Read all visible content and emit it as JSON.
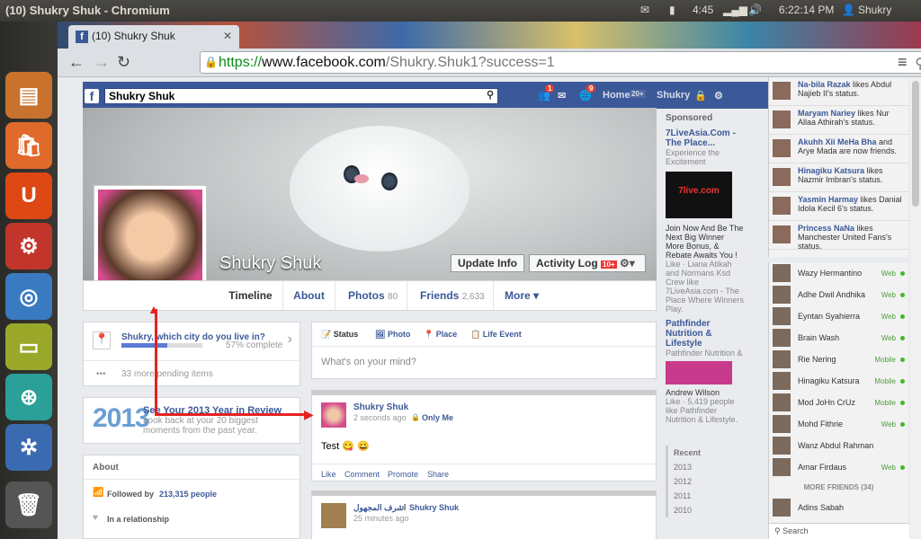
{
  "os": {
    "window_title": "(10) Shukry Shuk - Chromium",
    "time_left": "4:45",
    "clock": "6:22:14 PM",
    "user": "Shukry"
  },
  "browser": {
    "tab_title": "(10) Shukry Shuk",
    "url_https": "https://",
    "url_host": "www.facebook.com",
    "url_path": "/Shukry.Shuk1?success=1"
  },
  "fb": {
    "search_value": "Shukry Shuk",
    "friend_req_badge": "1",
    "notif_badge": "9",
    "home_label": "Home",
    "home_count": "20+",
    "user_label": "Shukry"
  },
  "profile": {
    "name": "Shukry Shuk",
    "update_info": "Update Info",
    "activity_log": "Activity Log",
    "activity_badge": "10+",
    "tabs": [
      {
        "label": "Timeline",
        "count": ""
      },
      {
        "label": "About",
        "count": ""
      },
      {
        "label": "Photos",
        "count": "80"
      },
      {
        "label": "Friends",
        "count": "2,633"
      },
      {
        "label": "More ▾",
        "count": ""
      }
    ]
  },
  "left": {
    "city_q": "Shukry, which city do you live in?",
    "city_pct": "57% complete",
    "city_progress": 0.57,
    "pending": "33 more pending items",
    "year_big": "2013",
    "year_title": "See Your 2013 Year in Review",
    "year_sub": "Look back at your 20 biggest moments from the past year.",
    "about": "About",
    "followed_prefix": "Followed by",
    "followed_count": "213,315 people",
    "relationship": "In a relationship"
  },
  "composer": {
    "tabs": [
      "Status",
      "Photo",
      "Place",
      "Life Event"
    ],
    "placeholder": "What's on your mind?"
  },
  "post": {
    "author": "Shukry Shuk",
    "time": "2 seconds ago",
    "privacy": "Only Me",
    "text": "Test 😋 😀",
    "actions": [
      "Like",
      "Comment",
      "Promote",
      "Share"
    ]
  },
  "post2": {
    "author_arabic": "اشرف المجهول",
    "target": "Shukry Shuk",
    "time": "25 minutes ago"
  },
  "ads": {
    "header": "Sponsored",
    "ad1_title": "7LiveAsia.Com - The Place...",
    "ad1_sub": "Experience the Excitement",
    "ad1_img": "7live.com",
    "ad1_body": "Join Now And Be The Next Big Winner More Bonus, & Rebate Awaits You !",
    "ad1_like": "Like · Liana Atikah and Normans Ksd Crew like 7LiveAsia.com - The Place Where Winners Play.",
    "ad2_title": "Pathfinder Nutrition & Lifestyle",
    "ad2_sub": "Pathfinder Nutrition &",
    "ad2_person": "Andrew Wilson",
    "ad2_like": "Like · 5,419 people like Pathfinder Nutrition & Lifestyle."
  },
  "years": {
    "recent": "Recent",
    "list": [
      "2013",
      "2012",
      "2011",
      "2010"
    ]
  },
  "ticker": [
    {
      "name": "Na-bila Razak",
      "text": "likes Abdul Najieb II's status."
    },
    {
      "name": "Maryam Nariey",
      "text": "likes Nur Allaa Athirah's status."
    },
    {
      "name": "Akuhh Xii MeHa Bha",
      "text": "and Arye Mada are now friends."
    },
    {
      "name": "Hinagiku Katsura",
      "text": "likes Nazmir Imbran's status."
    },
    {
      "name": "Yasmin Harmay",
      "text": "likes Danial Idola Kecil 6's status."
    },
    {
      "name": "Princess NaNa",
      "text": "likes Manchester United Fans's status."
    }
  ],
  "chat": [
    {
      "name": "Wazy Hermantino",
      "status": "Web"
    },
    {
      "name": "Adhe Dwil Andhika",
      "status": "Web"
    },
    {
      "name": "Eyntan Syahierra",
      "status": "Web"
    },
    {
      "name": "Brain Wash",
      "status": "Web"
    },
    {
      "name": "Rie Nering",
      "status": "Mobile"
    },
    {
      "name": "Hinagiku Katsura",
      "status": "Mobile"
    },
    {
      "name": "Mod JoHn CrUz",
      "status": "Mobile"
    },
    {
      "name": "Mohd Fithrie",
      "status": "Web"
    },
    {
      "name": "Wanz Abdul Rahman",
      "status": ""
    },
    {
      "name": "Amar Firdaus",
      "status": "Web"
    }
  ],
  "chat_more": "MORE FRIENDS (34)",
  "chat_last": "Adins Sabah",
  "chat_search": "Search"
}
